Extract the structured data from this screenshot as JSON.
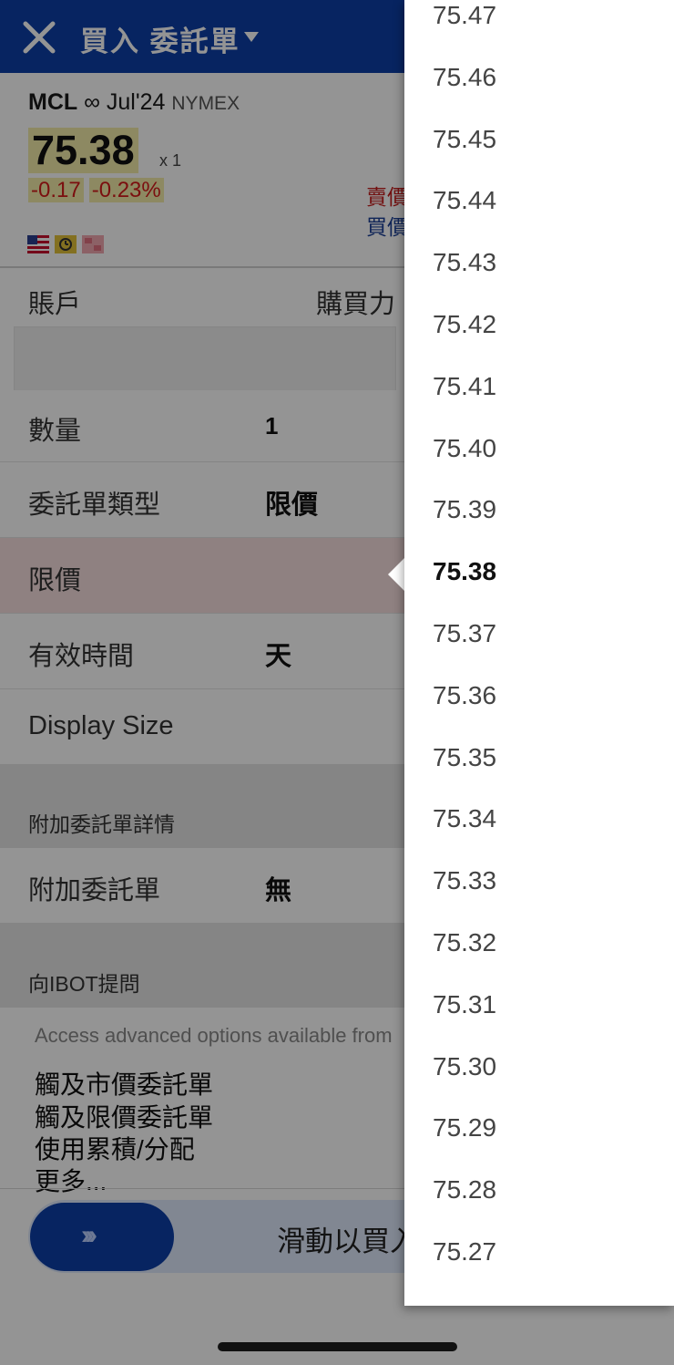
{
  "header": {
    "title": "買入 委託單"
  },
  "quote": {
    "symbol": "MCL",
    "infinity": "∞",
    "expiry": "Jul'24",
    "exchange": "NYMEX",
    "last": "75.38",
    "multiplier": "x 1",
    "change": "-0.17",
    "change_pct": "-0.23%",
    "ask_label": "賣價",
    "bid_label": "買價"
  },
  "form": {
    "account_label": "賬戶",
    "buying_power_label": "購買力",
    "quantity_label": "數量",
    "quantity_value": "1",
    "order_type_label": "委託單類型",
    "order_type_value": "限價",
    "limit_price_label": "限價",
    "tif_label": "有效時間",
    "tif_value": "天",
    "display_size_label": "Display Size"
  },
  "attached": {
    "section_label": "附加委託單詳情",
    "label": "附加委託單",
    "value": "無"
  },
  "ibot": {
    "section_label": "向IBOT提問",
    "advanced_text": "Access advanced options available from",
    "links": [
      "觸及市價委託單",
      "觸及限價委託單",
      "使用累積/分配",
      "更多..."
    ]
  },
  "swipe": {
    "arrows": "›››",
    "label": "滑動以買入"
  },
  "picker": {
    "items": [
      "75.47",
      "75.46",
      "75.45",
      "75.44",
      "75.43",
      "75.42",
      "75.41",
      "75.40",
      "75.39",
      "75.38",
      "75.37",
      "75.36",
      "75.35",
      "75.34",
      "75.33",
      "75.32",
      "75.31",
      "75.30",
      "75.29",
      "75.28",
      "75.27"
    ],
    "selected": "75.38"
  },
  "colors": {
    "brand_blue": "#0d3fa8",
    "down_red": "#d41a1a",
    "highlight_yellow": "#f3ecaa"
  }
}
